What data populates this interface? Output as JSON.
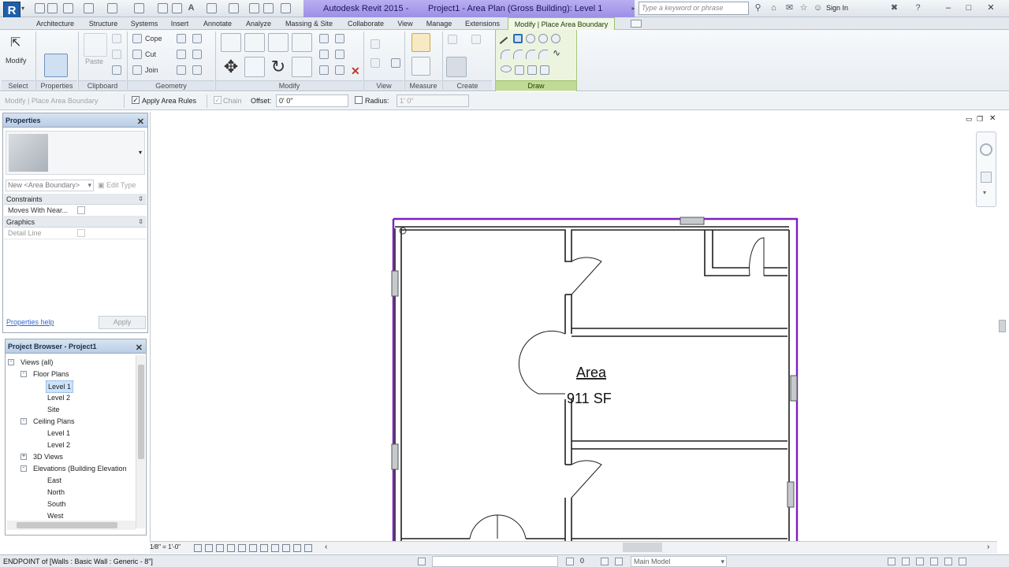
{
  "app": {
    "title": "Autodesk Revit 2015 -",
    "document_title": "Project1 - Area Plan (Gross Building): Level 1",
    "search_placeholder": "Type a keyword or phrase",
    "sign_in": "Sign In",
    "logo_letter": "R"
  },
  "tabs": [
    {
      "label": "Architecture"
    },
    {
      "label": "Structure"
    },
    {
      "label": "Systems"
    },
    {
      "label": "Insert"
    },
    {
      "label": "Annotate"
    },
    {
      "label": "Analyze"
    },
    {
      "label": "Massing & Site"
    },
    {
      "label": "Collaborate"
    },
    {
      "label": "View"
    },
    {
      "label": "Manage"
    },
    {
      "label": "Extensions"
    },
    {
      "label": "Modify | Place Area Boundary"
    }
  ],
  "ribbon": {
    "modify_label": "Modify",
    "paste_label": "Paste",
    "cope_label": "Cope",
    "cut_label": "Cut",
    "join_label": "Join",
    "panels": {
      "select": "Select",
      "properties": "Properties",
      "clipboard": "Clipboard",
      "geometry": "Geometry",
      "modify": "Modify",
      "view": "View",
      "measure": "Measure",
      "create": "Create",
      "draw": "Draw"
    }
  },
  "options_bar": {
    "context": "Modify | Place Area Boundary",
    "apply_area_rules": "Apply Area Rules",
    "apply_area_rules_checked": true,
    "chain": "Chain",
    "offset_label": "Offset:",
    "offset_value": "0'  0\"",
    "radius_label": "Radius:",
    "radius_value": "1'  0\""
  },
  "properties": {
    "title": "Properties",
    "type_selector": "New <Area Boundary>",
    "edit_type": "Edit Type",
    "sections": {
      "constraints": "Constraints",
      "graphics": "Graphics"
    },
    "rows": {
      "moves_with_nearby": "Moves With Near...",
      "detail_line": "Detail Line"
    },
    "help": "Properties help",
    "apply": "Apply"
  },
  "project_browser": {
    "title": "Project Browser - Project1",
    "items": [
      {
        "label": "Views (all)",
        "level": 0,
        "toggle": "-"
      },
      {
        "label": "Floor Plans",
        "level": 1,
        "toggle": "-"
      },
      {
        "label": "Level 1",
        "level": 2,
        "selected": true
      },
      {
        "label": "Level 2",
        "level": 2
      },
      {
        "label": "Site",
        "level": 2
      },
      {
        "label": "Ceiling Plans",
        "level": 1,
        "toggle": "-"
      },
      {
        "label": "Level 1",
        "level": 2
      },
      {
        "label": "Level 2",
        "level": 2
      },
      {
        "label": "3D Views",
        "level": 1,
        "toggle": "+"
      },
      {
        "label": "Elevations (Building Elevation",
        "level": 1,
        "toggle": "-"
      },
      {
        "label": "East",
        "level": 2
      },
      {
        "label": "North",
        "level": 2
      },
      {
        "label": "South",
        "level": 2
      },
      {
        "label": "West",
        "level": 2
      }
    ]
  },
  "drawing": {
    "area_tag_name": "Area",
    "area_tag_value": "911 SF",
    "boundary_color": "#7d1fc1",
    "wall_color": "#1e1e1e"
  },
  "view_control": {
    "scale": "1/8\" = 1'-0\""
  },
  "status_bar": {
    "message": "ENDPOINT  of [Walls : Basic Wall : Generic - 8\"]",
    "model": "Main Model",
    "count": "0"
  },
  "colors": {
    "title_accent": "#9d8fe6",
    "context_tab": "#9fc36c",
    "revit_blue": "#1f5fa8"
  }
}
